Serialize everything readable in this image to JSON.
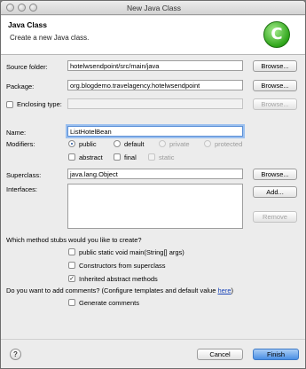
{
  "window": {
    "title": "New Java Class"
  },
  "header": {
    "title": "Java Class",
    "subtitle": "Create a new Java class."
  },
  "source_folder": {
    "label": "Source folder:",
    "value": "hotelwsendpoint/src/main/java",
    "browse": "Browse..."
  },
  "package": {
    "label": "Package:",
    "value": "org.blogdemo.travelagency.hotelwsendpoint",
    "browse": "Browse..."
  },
  "enclosing": {
    "label": "Enclosing type:",
    "value": "",
    "browse": "Browse..."
  },
  "name": {
    "label": "Name:",
    "value": "ListHotelBean"
  },
  "modifiers": {
    "label": "Modifiers:",
    "public": "public",
    "default": "default",
    "private": "private",
    "protected": "protected",
    "abstract": "abstract",
    "final": "final",
    "static": "static",
    "selected": "public"
  },
  "superclass": {
    "label": "Superclass:",
    "value": "java.lang.Object",
    "browse": "Browse..."
  },
  "interfaces": {
    "label": "Interfaces:",
    "add": "Add...",
    "remove": "Remove"
  },
  "stubs": {
    "question": "Which method stubs would you like to create?",
    "main": {
      "label": "public static void main(String[] args)",
      "checked": false
    },
    "constructors": {
      "label": "Constructors from superclass",
      "checked": false
    },
    "inherited": {
      "label": "Inherited abstract methods",
      "checked": true
    }
  },
  "comments": {
    "question": "Do you want to add comments? (Configure templates and default value ",
    "link": "here",
    "close": ")",
    "generate": {
      "label": "Generate comments",
      "checked": false
    }
  },
  "footer": {
    "help": "?",
    "cancel": "Cancel",
    "finish": "Finish"
  }
}
